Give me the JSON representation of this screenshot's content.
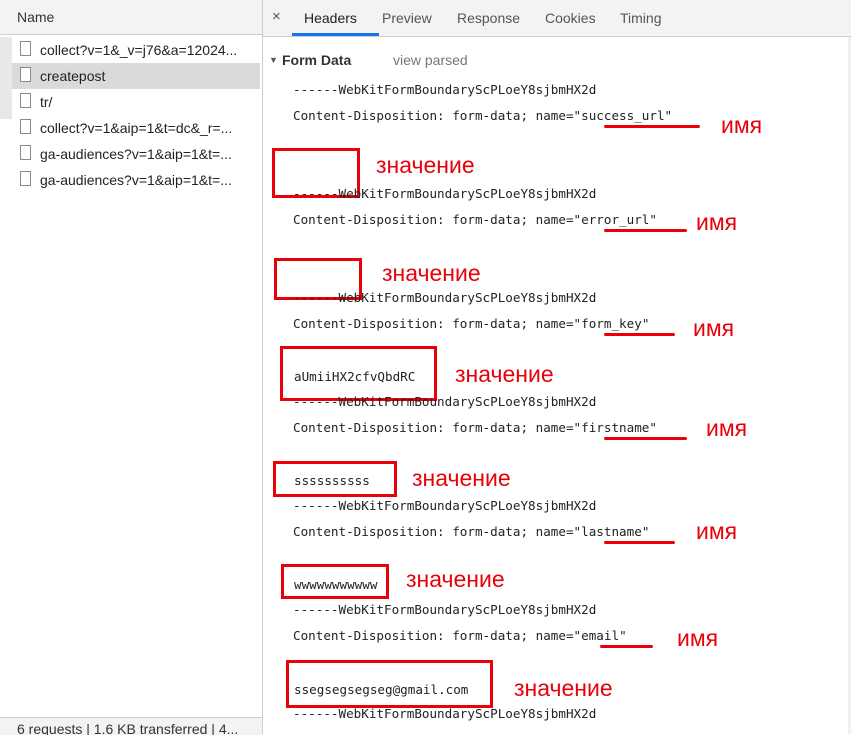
{
  "left_panel": {
    "header": "Name",
    "requests": [
      {
        "name": "collect?v=1&_v=j76&a=12024..."
      },
      {
        "name": "createpost"
      },
      {
        "name": "tr/"
      },
      {
        "name": "collect?v=1&aip=1&t=dc&_r=..."
      },
      {
        "name": "ga-audiences?v=1&aip=1&t=..."
      },
      {
        "name": "ga-audiences?v=1&aip=1&t=..."
      }
    ],
    "footer": "6 requests | 1.6 KB transferred | 4..."
  },
  "tabs": {
    "close": "×",
    "headers": "Headers",
    "preview": "Preview",
    "response": "Response",
    "cookies": "Cookies",
    "timing": "Timing",
    "active": "Headers"
  },
  "form_data": {
    "title": "Form Data",
    "view_parsed": "view parsed",
    "boundary": "------WebKitFormBoundaryScPLoeY8sjbmHX2d",
    "disposition_prefix": "Content-Disposition: form-data; name=",
    "fields": [
      {
        "name": "success_url",
        "value": ""
      },
      {
        "name": "error_url",
        "value": ""
      },
      {
        "name": "form_key",
        "value": "aUmiiHX2cfvQbdRC"
      },
      {
        "name": "firstname",
        "value": "ssssssssss"
      },
      {
        "name": "lastname",
        "value": "wwwwwwwwwww"
      },
      {
        "name": "email",
        "value": "ssegsegsegseg@gmail.com"
      }
    ]
  },
  "annotations": {
    "name_label": "имя",
    "value_label": "значение",
    "color": "#e8000a"
  },
  "colors": {
    "accent": "#1a73e8",
    "selected_row": "#dadada",
    "toolbar": "#f3f3f3"
  }
}
